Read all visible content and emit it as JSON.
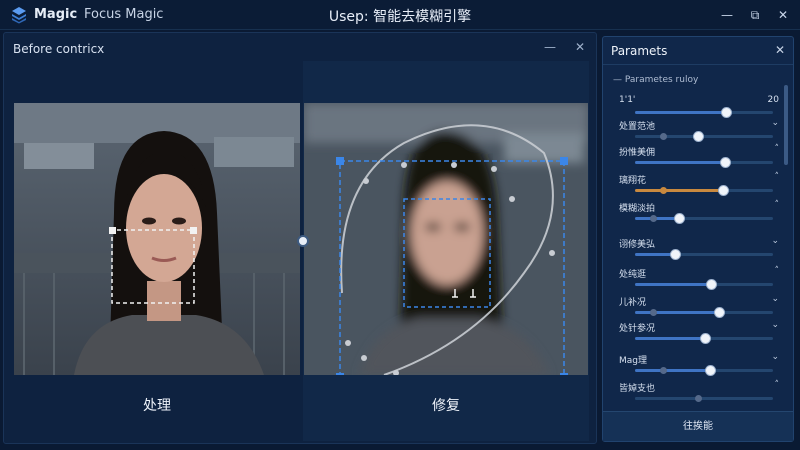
{
  "app": {
    "name": "Magic",
    "subtitle": "Focus Magic",
    "window_title": "Usep: 智能去模糊引擎",
    "controls": {
      "minimize": "—",
      "maximize": "⧉",
      "close": "✕"
    }
  },
  "compare": {
    "title": "Before contricx",
    "before_label": "处理",
    "after_label": "修复",
    "pin_icon": "—",
    "close": "✕"
  },
  "params": {
    "title": "Paramets",
    "subtitle": "— Parametes ruloy",
    "close": "✕",
    "items": [
      {
        "label": "1'1'",
        "value": "20",
        "arrow": "",
        "level": 0.66,
        "fill": "#3f74c4"
      },
      {
        "label": "处置范池",
        "value": "",
        "arrow": "⌄",
        "level": 0.46,
        "fill": "#24466f"
      },
      {
        "label": "扮惟美佣",
        "value": "",
        "arrow": "˄",
        "level": 0.65,
        "fill": "#3f74c4"
      },
      {
        "label": "璃翔花",
        "value": "",
        "arrow": "˄",
        "level": 0.64,
        "fill": "#c9893f"
      },
      {
        "label": "模糊淡拍",
        "value": "",
        "arrow": "˄",
        "level": 0.32,
        "fill": "#3f74c4"
      },
      {
        "label": "诩修美弘",
        "value": "",
        "arrow": "⌄",
        "level": 0.29,
        "fill": "#3f74c4"
      },
      {
        "label": "处纯逛",
        "value": "",
        "arrow": "˄",
        "level": 0.55,
        "fill": "#3f74c4"
      },
      {
        "label": "儿补况",
        "value": "",
        "arrow": "⌄",
        "level": 0.61,
        "fill": "#3f74c4"
      },
      {
        "label": "处针参况",
        "value": "",
        "arrow": "⌄",
        "level": 0.51,
        "fill": "#3f74c4"
      },
      {
        "label": "Mag理",
        "value": "",
        "arrow": "⌄",
        "level": 0.54,
        "fill": "#3f74c4"
      },
      {
        "label": "皆婥支也",
        "value": "",
        "arrow": "˄",
        "level": 0.46,
        "fill": "#24466f"
      }
    ],
    "apply_label": "往挨能"
  }
}
